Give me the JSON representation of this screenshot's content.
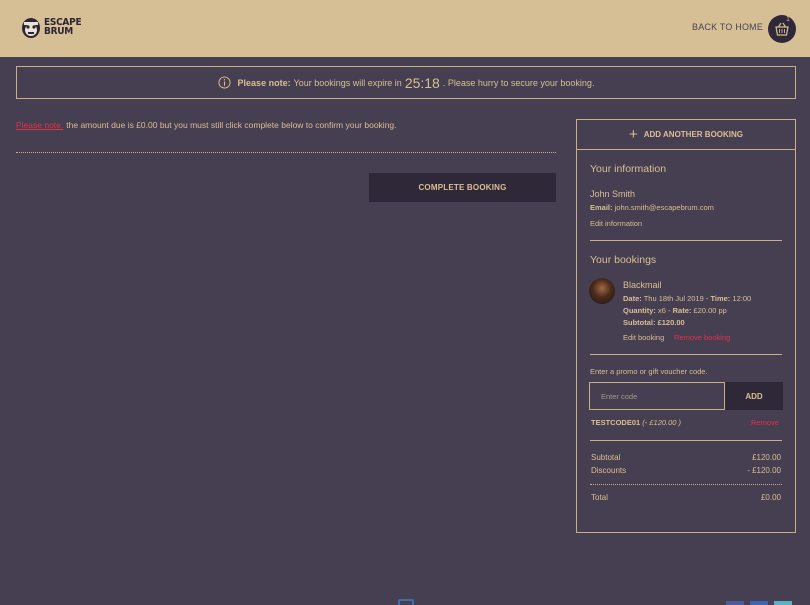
{
  "header": {
    "logo_line1": "ESCAPE",
    "logo_line2": "BRUM",
    "back_home": "BACK TO HOME",
    "cart_count": "1"
  },
  "notice": {
    "please_note": "Please note:",
    "text_before": "Your bookings will expire in",
    "timer": "25:18",
    "text_after": ". Please hurry to secure your booking."
  },
  "amount_note": {
    "label": "Please note:",
    "text": "the amount due is £0.00 but you must still click complete below to confirm your booking."
  },
  "complete_button": "COMPLETE BOOKING",
  "panel": {
    "add_another": "ADD ANOTHER BOOKING",
    "your_information": "Your information",
    "name": "John Smith",
    "email_label": "Email:",
    "email": "john.smith@escapebrum.com",
    "edit_information": "Edit information",
    "your_bookings": "Your bookings",
    "booking": {
      "title": "Blackmail",
      "date_label": "Date:",
      "date": "Thu 18th Jul 2019",
      "time_label": "Time:",
      "time": "12:00",
      "quantity_label": "Quantity:",
      "quantity": "x6",
      "rate_label": "Rate:",
      "rate": "£20.00 pp",
      "subtotal_label": "Subtotal:",
      "subtotal": "£120.00",
      "edit": "Edit booking",
      "remove": "Remove booking"
    },
    "promo_prompt": "Enter a promo or gift voucher code.",
    "promo_placeholder": "Enter code",
    "promo_add": "ADD",
    "applied_code": "TESTCODE01",
    "applied_amount": "(- £120.00 )",
    "applied_remove": "Remove",
    "subtotal_label": "Subtotal",
    "subtotal_value": "£120.00",
    "discounts_label": "Discounts",
    "discounts_value": "- £120.00",
    "total_label": "Total",
    "total_value": "£0.00"
  },
  "colors": {
    "background": "#463f51",
    "header": "#d6bf95",
    "accent": "#d9bf92",
    "danger": "#e0304a",
    "button": "#2f2838"
  }
}
